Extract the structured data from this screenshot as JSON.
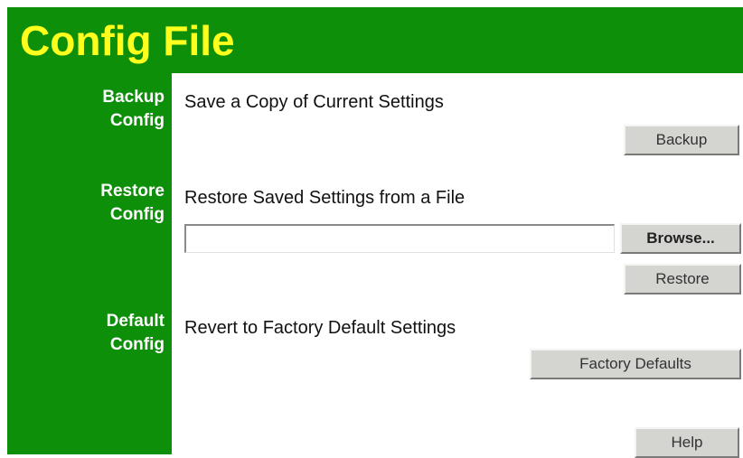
{
  "page": {
    "title": "Config File"
  },
  "sidebar": {
    "backup": [
      "Backup",
      "Config"
    ],
    "restore": [
      "Restore",
      "Config"
    ],
    "default": [
      "Default",
      "Config"
    ]
  },
  "backup_section": {
    "heading": "Save a Copy of Current Settings",
    "button": "Backup"
  },
  "restore_section": {
    "heading": "Restore Saved Settings from a File",
    "file_value": "",
    "browse_button": "Browse...",
    "restore_button": "Restore"
  },
  "default_section": {
    "heading": "Revert to Factory Default Settings",
    "button": "Factory Defaults"
  },
  "help_button": "Help",
  "colors": {
    "brand_green": "#0d8f0a",
    "title_yellow": "#ffff1e",
    "button_face": "#d4d4d0"
  }
}
